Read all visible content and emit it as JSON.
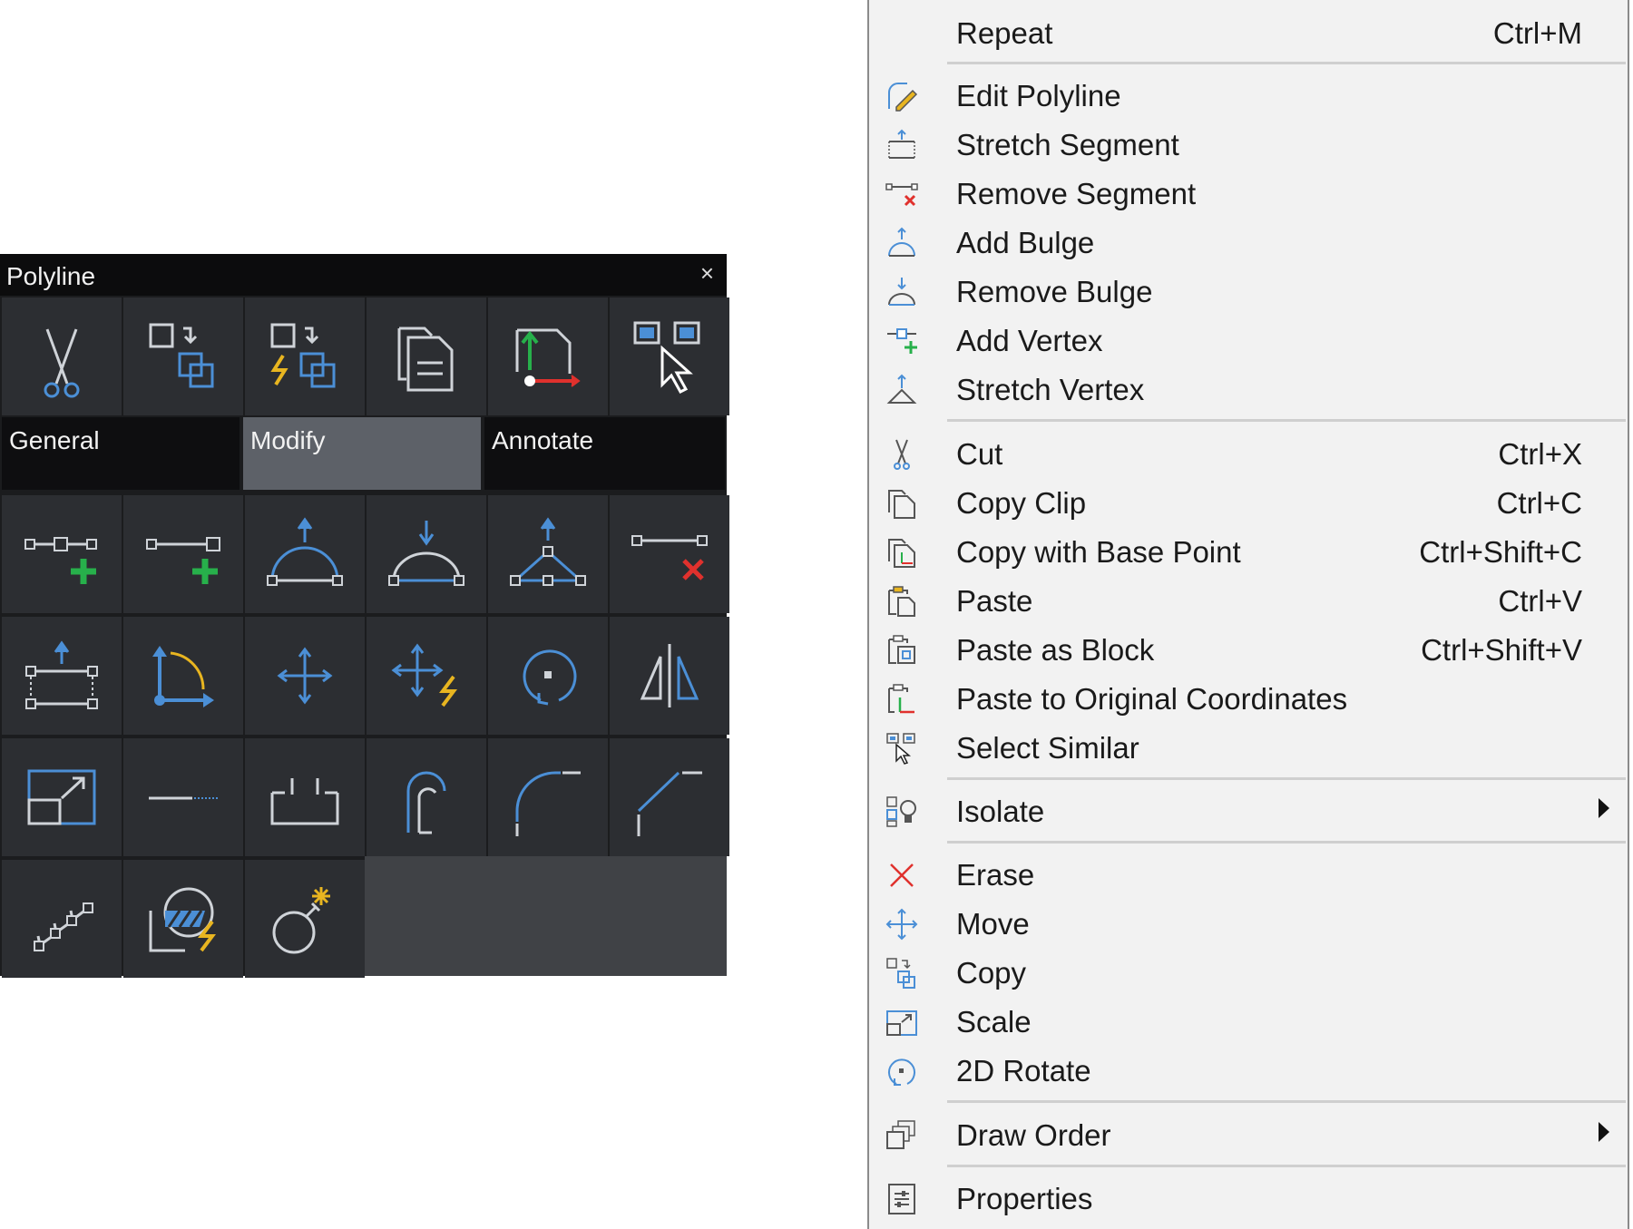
{
  "quad": {
    "title": "Polyline",
    "close": "×",
    "tabs": [
      "General",
      "Modify",
      "Annotate"
    ],
    "top_row_icons": [
      "cut-icon",
      "copy-objects-icon",
      "quick-copy-icon",
      "paste-icon",
      "paste-to-coordinates-icon",
      "select-similar-icon"
    ],
    "grid_icons": [
      "add-vertex-icon",
      "add-end-vertex-icon",
      "add-bulge-icon",
      "remove-bulge-icon",
      "stretch-vertex-icon",
      "remove-segment-icon",
      "stretch-segment-icon",
      "rotate-ucs-icon",
      "move-icon",
      "quick-move-icon",
      "rotate-icon",
      "mirror-icon",
      "scale-icon",
      "extend-icon",
      "break-icon",
      "offset-icon",
      "fillet-icon",
      "chamfer-icon",
      "join-icon",
      "hatch-icon",
      "explode-icon"
    ]
  },
  "menu": {
    "items": [
      {
        "label": "Repeat",
        "shortcut": "Ctrl+M",
        "icon": ""
      },
      {
        "label": "Edit Polyline",
        "shortcut": "",
        "icon": "edit-polyline-icon"
      },
      {
        "label": "Stretch Segment",
        "shortcut": "",
        "icon": "stretch-segment-icon"
      },
      {
        "label": "Remove Segment",
        "shortcut": "",
        "icon": "remove-segment-icon"
      },
      {
        "label": "Add Bulge",
        "shortcut": "",
        "icon": "add-bulge-icon"
      },
      {
        "label": "Remove Bulge",
        "shortcut": "",
        "icon": "remove-bulge-icon"
      },
      {
        "label": "Add Vertex",
        "shortcut": "",
        "icon": "add-vertex-icon"
      },
      {
        "label": "Stretch Vertex",
        "shortcut": "",
        "icon": "stretch-vertex-icon"
      },
      {
        "label": "Cut",
        "shortcut": "Ctrl+X",
        "icon": "cut-icon"
      },
      {
        "label": "Copy Clip",
        "shortcut": "Ctrl+C",
        "icon": "copy-clip-icon"
      },
      {
        "label": "Copy with Base Point",
        "shortcut": "Ctrl+Shift+C",
        "icon": "copy-base-point-icon"
      },
      {
        "label": "Paste",
        "shortcut": "Ctrl+V",
        "icon": "paste-icon"
      },
      {
        "label": "Paste as Block",
        "shortcut": "Ctrl+Shift+V",
        "icon": "paste-block-icon"
      },
      {
        "label": "Paste to Original Coordinates",
        "shortcut": "",
        "icon": "paste-original-coords-icon"
      },
      {
        "label": "Select Similar",
        "shortcut": "",
        "icon": "select-similar-icon"
      },
      {
        "label": "Isolate",
        "shortcut": "",
        "icon": "isolate-icon",
        "submenu": true
      },
      {
        "label": "Erase",
        "shortcut": "",
        "icon": "erase-icon"
      },
      {
        "label": "Move",
        "shortcut": "",
        "icon": "move-icon"
      },
      {
        "label": "Copy",
        "shortcut": "",
        "icon": "copy-icon"
      },
      {
        "label": "Scale",
        "shortcut": "",
        "icon": "scale-icon"
      },
      {
        "label": "2D Rotate",
        "shortcut": "",
        "icon": "rotate-2d-icon"
      },
      {
        "label": "Draw Order",
        "shortcut": "",
        "icon": "draw-order-icon",
        "submenu": true
      },
      {
        "label": "Properties",
        "shortcut": "",
        "icon": "properties-icon"
      }
    ]
  },
  "colors": {
    "icon_blue": "#4b8fd6",
    "icon_yellow": "#e8b520",
    "icon_green": "#27b04b",
    "icon_red": "#e0312d",
    "panel_bg": "#2c2e32",
    "menu_bg": "#f2f2f2"
  }
}
